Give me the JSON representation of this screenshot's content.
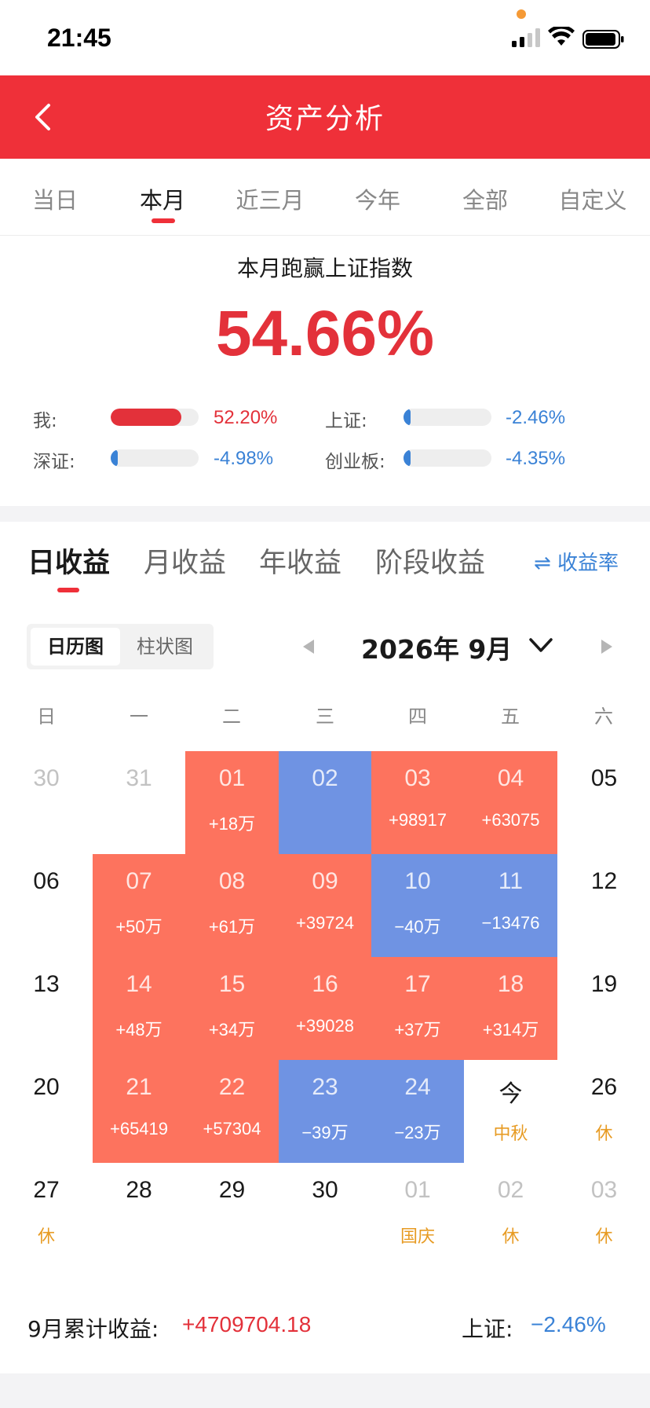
{
  "status_bar": {
    "time": "21:45"
  },
  "header": {
    "title": "资产分析"
  },
  "period_tabs": [
    {
      "label": "当日",
      "active": false
    },
    {
      "label": "本月",
      "active": true
    },
    {
      "label": "近三月",
      "active": false
    },
    {
      "label": "今年",
      "active": false
    },
    {
      "label": "全部",
      "active": false
    },
    {
      "label": "自定义",
      "active": false
    }
  ],
  "performance": {
    "title": "本月跑赢上证指数",
    "value": "54.66%",
    "comparisons": [
      {
        "label": "我:",
        "value": "52.20%",
        "fill": 0.8
      },
      {
        "label": "上证:",
        "value": "-2.46%",
        "fill": 0.03
      },
      {
        "label": "深证:",
        "value": "-4.98%",
        "fill": 0.06
      },
      {
        "label": "创业板:",
        "value": "-4.35%",
        "fill": 0.05
      }
    ]
  },
  "profit_tabs": [
    {
      "label": "日收益",
      "active": true
    },
    {
      "label": "月收益",
      "active": false
    },
    {
      "label": "年收益",
      "active": false
    },
    {
      "label": "阶段收益",
      "active": false
    }
  ],
  "rate_toggle": "⇌ 收益率",
  "view_switch": [
    {
      "label": "日历图",
      "active": true
    },
    {
      "label": "柱状图",
      "active": false
    }
  ],
  "month_label": "2026年 9月",
  "weekdays": [
    "日",
    "一",
    "二",
    "三",
    "四",
    "五",
    "六"
  ],
  "calendar": [
    [
      {
        "day": "30",
        "state": "muted"
      },
      {
        "day": "31",
        "state": "muted"
      },
      {
        "day": "01",
        "state": "pos",
        "value": "+18万"
      },
      {
        "day": "02",
        "state": "neg",
        "value": ""
      },
      {
        "day": "03",
        "state": "pos",
        "value": "+98917"
      },
      {
        "day": "04",
        "state": "pos",
        "value": "+63075"
      },
      {
        "day": "05",
        "state": "normal"
      }
    ],
    [
      {
        "day": "06",
        "state": "normal"
      },
      {
        "day": "07",
        "state": "pos",
        "value": "+50万"
      },
      {
        "day": "08",
        "state": "pos",
        "value": "+61万"
      },
      {
        "day": "09",
        "state": "pos",
        "value": "+39724"
      },
      {
        "day": "10",
        "state": "neg",
        "value": "−40万"
      },
      {
        "day": "11",
        "state": "neg",
        "value": "−13476"
      },
      {
        "day": "12",
        "state": "normal"
      }
    ],
    [
      {
        "day": "13",
        "state": "normal"
      },
      {
        "day": "14",
        "state": "pos",
        "value": "+48万"
      },
      {
        "day": "15",
        "state": "pos",
        "value": "+34万"
      },
      {
        "day": "16",
        "state": "pos",
        "value": "+39028"
      },
      {
        "day": "17",
        "state": "pos",
        "value": "+37万"
      },
      {
        "day": "18",
        "state": "pos",
        "value": "+314万"
      },
      {
        "day": "19",
        "state": "normal"
      }
    ],
    [
      {
        "day": "20",
        "state": "normal"
      },
      {
        "day": "21",
        "state": "pos",
        "value": "+65419"
      },
      {
        "day": "22",
        "state": "pos",
        "value": "+57304"
      },
      {
        "day": "23",
        "state": "neg",
        "value": "−39万"
      },
      {
        "day": "24",
        "state": "neg",
        "value": "−23万"
      },
      {
        "day": "今",
        "state": "normal",
        "note": "中秋"
      },
      {
        "day": "26",
        "state": "normal",
        "note": "休"
      }
    ],
    [
      {
        "day": "27",
        "state": "normal",
        "note": "休"
      },
      {
        "day": "28",
        "state": "normal"
      },
      {
        "day": "29",
        "state": "normal"
      },
      {
        "day": "30",
        "state": "normal"
      },
      {
        "day": "01",
        "state": "muted",
        "note": "国庆"
      },
      {
        "day": "02",
        "state": "muted",
        "note": "休"
      },
      {
        "day": "03",
        "state": "muted",
        "note": "休"
      }
    ]
  ],
  "summary": {
    "label": "9月累计收益:",
    "value": "+4709704.18",
    "index_label": "上证:",
    "index_value": "−2.46%"
  },
  "colors": {
    "brand_red": "#ef3039",
    "gain": "#fd735e",
    "loss": "#6f93e3",
    "positive_text": "#e3313a",
    "negative_text": "#3a82d6",
    "holiday": "#e79b23",
    "status_dot": "#f59a36"
  },
  "icons": [
    "back-arrow-icon",
    "signal-icon",
    "wifi-icon",
    "battery-icon",
    "swap-icon",
    "prev-month-icon",
    "next-month-icon",
    "dropdown-chevron-icon"
  ]
}
